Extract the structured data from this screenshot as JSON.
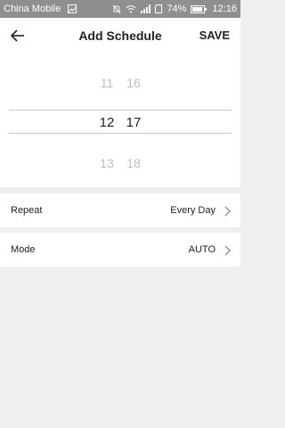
{
  "status_bar": {
    "carrier": "China Mobile",
    "icons": [
      "image-icon",
      "mute-icon",
      "wifi-icon",
      "signal-icon",
      "sd-card-icon",
      "battery-icon"
    ],
    "battery": "74%",
    "time": "12:16"
  },
  "header": {
    "back_icon": "arrow-left-icon",
    "title": "Add Schedule",
    "save_label": "SAVE"
  },
  "time_picker": {
    "hours": [
      "11",
      "12",
      "13"
    ],
    "minutes": [
      "16",
      "17",
      "18"
    ],
    "selected_hour": "12",
    "selected_minute": "17"
  },
  "settings": {
    "repeat": {
      "label": "Repeat",
      "value": "Every Day"
    },
    "mode": {
      "label": "Mode",
      "value": "AUTO"
    }
  },
  "colors": {
    "status_bar": "#8f8f8f",
    "background": "#efefef",
    "dim_text": "#bdbdbd"
  }
}
